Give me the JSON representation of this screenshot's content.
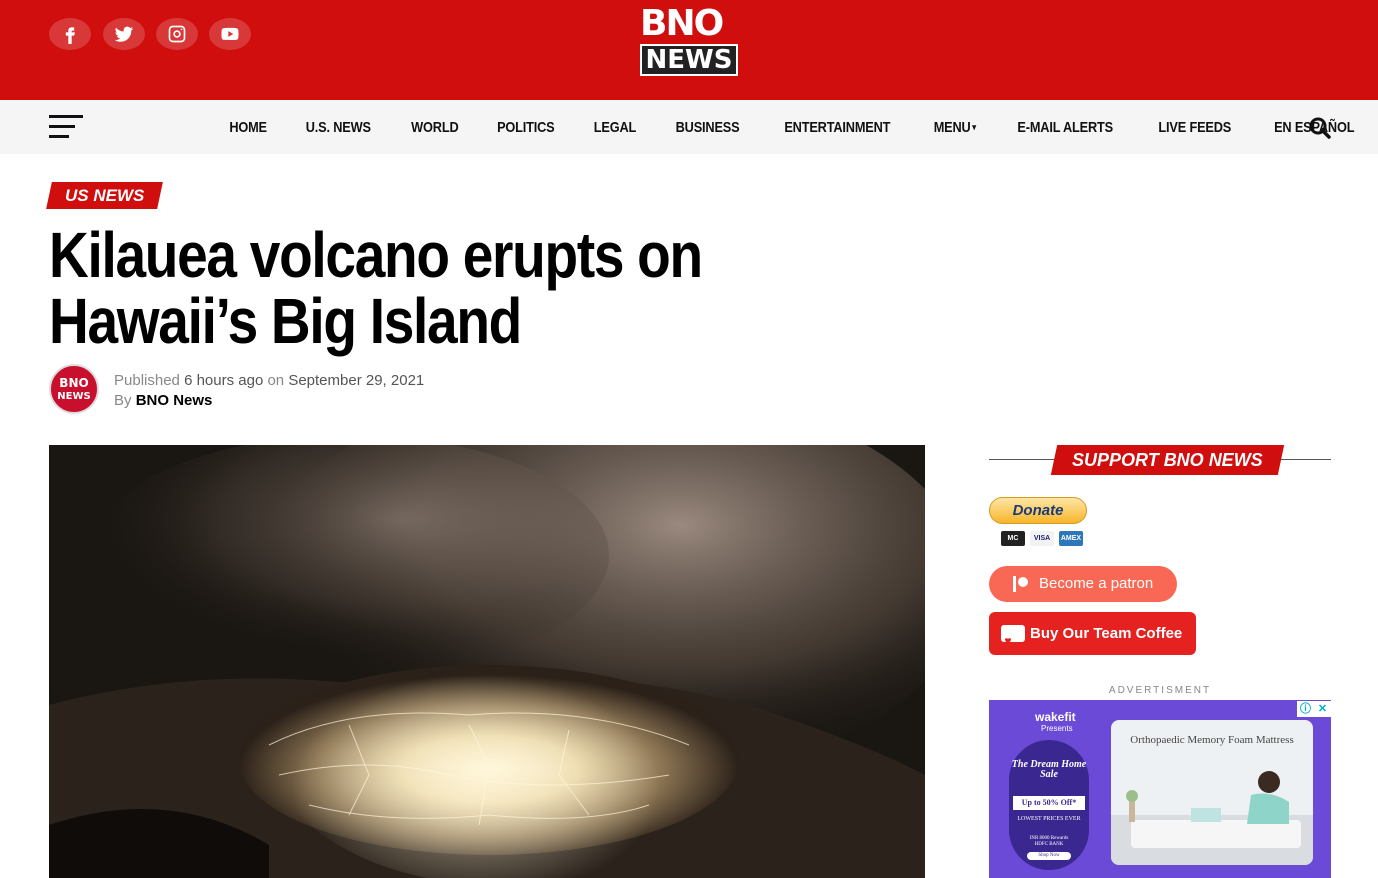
{
  "header": {
    "logo_top": "BNO",
    "logo_bottom": "NEWS",
    "social": [
      "facebook-icon",
      "twitter-icon",
      "instagram-icon",
      "youtube-icon"
    ],
    "brand_color": "#d00e0d"
  },
  "nav": {
    "items": [
      "HOME",
      "U.S. NEWS",
      "WORLD",
      "POLITICS",
      "LEGAL",
      "BUSINESS",
      "ENTERTAINMENT",
      "MENU",
      "E-MAIL ALERTS",
      "LIVE FEEDS",
      "EN ESPAÑOL"
    ],
    "menu_caret": "▾"
  },
  "article": {
    "category": "US NEWS",
    "title": "Kilauea volcano erupts on Hawaii’s Big Island",
    "avatar_top": "BNO",
    "avatar_bottom": "NEWS",
    "published_label": "Published",
    "published_relative": "6 hours ago",
    "on_label": "on",
    "date": "September 29, 2021",
    "by_label": "By",
    "author": "BNO News"
  },
  "sidebar": {
    "support_title": "SUPPORT BNO NEWS",
    "donate_label": "Donate",
    "cards": [
      "MC",
      "VISA",
      "AMEX"
    ],
    "patron_label": "Become a patron",
    "coffee_label": "Buy Our Team Coffee",
    "adv_label": "ADVERTISMENT",
    "ad": {
      "brand": "wakefit",
      "presents": "Presents",
      "sale_title": "The Dream Home Sale",
      "offer": "Up to 50% Off*",
      "lowest": "LOWEST PRICES EVER",
      "rewards": "INR 8000 Rewards",
      "bank": "HDFC BANK",
      "shop": "Shop Now",
      "product": "Orthopaedic Memory Foam Mattress",
      "info": "ⓘ",
      "close": "✕"
    }
  }
}
